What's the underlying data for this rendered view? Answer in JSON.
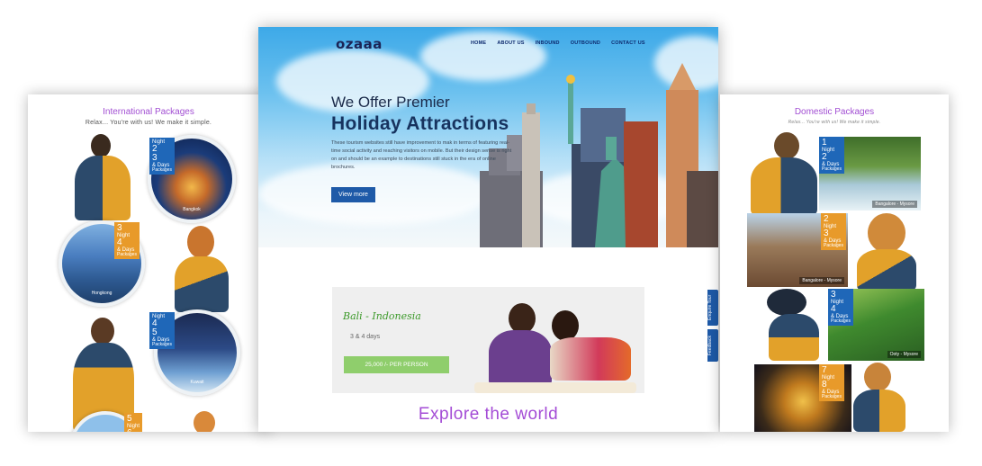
{
  "colors": {
    "accent_purple": "#a44cd6",
    "nav_blue": "#1e5aa8",
    "price_green": "#8fce6c",
    "badge_blue": "#1f67b8",
    "badge_orange": "#e89a2a"
  },
  "left": {
    "title": "International Packages",
    "subtitle": "Relax... You're with us! We make it simple.",
    "packages": [
      {
        "n1": "2",
        "w1": "Night",
        "n2": "3",
        "w2": "& Days",
        "pk": "Packages",
        "caption": "Bangkok"
      },
      {
        "n1": "3",
        "w1": "Night",
        "n2": "4",
        "w2": "& Days",
        "pk": "Packages",
        "caption": "Hongkong"
      },
      {
        "n1": "4",
        "w1": "Night",
        "n2": "5",
        "w2": "& Days",
        "pk": "Packages",
        "caption": "Kuwait"
      },
      {
        "n1": "5",
        "w1": "Night",
        "n2": "6",
        "w2": "& Days",
        "pk": "Packages",
        "caption": ""
      }
    ]
  },
  "main": {
    "logo": "ozaaa",
    "nav": [
      "HOME",
      "ABOUT US",
      "INBOUND",
      "OUTBOUND",
      "CONTACT US"
    ],
    "hero_pre": "We Offer Premier",
    "hero_title": "Holiday  Attractions",
    "hero_desc": "These tourism websites still have improvement to mak in terms of featuring real-time social activity and reaching visitors on mobile. But their design sense is right on and should be an example to destinations still stuck in the era of online brochures.",
    "hero_button": "View more",
    "offer_title": "Bali - Indonesia",
    "offer_days": "3 & 4 days",
    "offer_price": "25,000 /- PER PERSON",
    "explore": "Explore the world",
    "side_tabs": [
      "Enquire Tour",
      "Feedback"
    ]
  },
  "right": {
    "title": "Domestic Packages",
    "subtitle": "Relax... You're with us! We make it simple.",
    "packages": [
      {
        "n1": "1",
        "w1": "Night",
        "n2": "2",
        "w2": "& Days",
        "pk": "Packages",
        "caption": "Bangalore - Mysore"
      },
      {
        "n1": "2",
        "w1": "Night",
        "n2": "3",
        "w2": "& Days",
        "pk": "Packages",
        "caption": "Bangalore - Mysore"
      },
      {
        "n1": "3",
        "w1": "Night",
        "n2": "4",
        "w2": "& Days",
        "pk": "Packages",
        "caption": "Ooty - Mysore"
      },
      {
        "n1": "7",
        "w1": "Night",
        "n2": "8",
        "w2": "& Days",
        "pk": "Packages",
        "caption": ""
      }
    ]
  }
}
